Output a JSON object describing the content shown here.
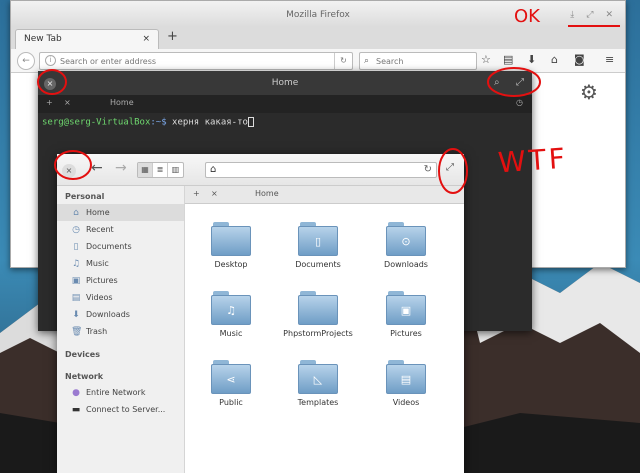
{
  "firefox": {
    "title": "Mozilla Firefox",
    "tab_label": "New Tab",
    "tab_close": "×",
    "new_tab": "+",
    "url_placeholder": "Search or enter address",
    "search_placeholder": "Search"
  },
  "terminal": {
    "title": "Home",
    "tab_add": "+",
    "tab_close": "×",
    "tab_label": "Home",
    "prompt_user": "serg@serg-VirtualBox",
    "prompt_path": ":~$",
    "command": " херня какая-то"
  },
  "files": {
    "sidebar": {
      "personal_header": "Personal",
      "personal": [
        "Home",
        "Recent",
        "Documents",
        "Music",
        "Pictures",
        "Videos",
        "Downloads",
        "Trash"
      ],
      "devices_header": "Devices",
      "network_header": "Network",
      "network": [
        "Entire Network",
        "Connect to Server..."
      ]
    },
    "tab_add": "+",
    "tab_close": "×",
    "tab_label": "Home",
    "folders": [
      "Desktop",
      "Documents",
      "Downloads",
      "Music",
      "PhpstormProjects",
      "Pictures",
      "Public",
      "Templates",
      "Videos"
    ]
  },
  "annotations": {
    "ok": "OK",
    "wtf": "WTF"
  },
  "colors": {
    "annotation": "#e31010",
    "folder": "#7aa7cf",
    "terminal_user": "#6fd86f"
  }
}
